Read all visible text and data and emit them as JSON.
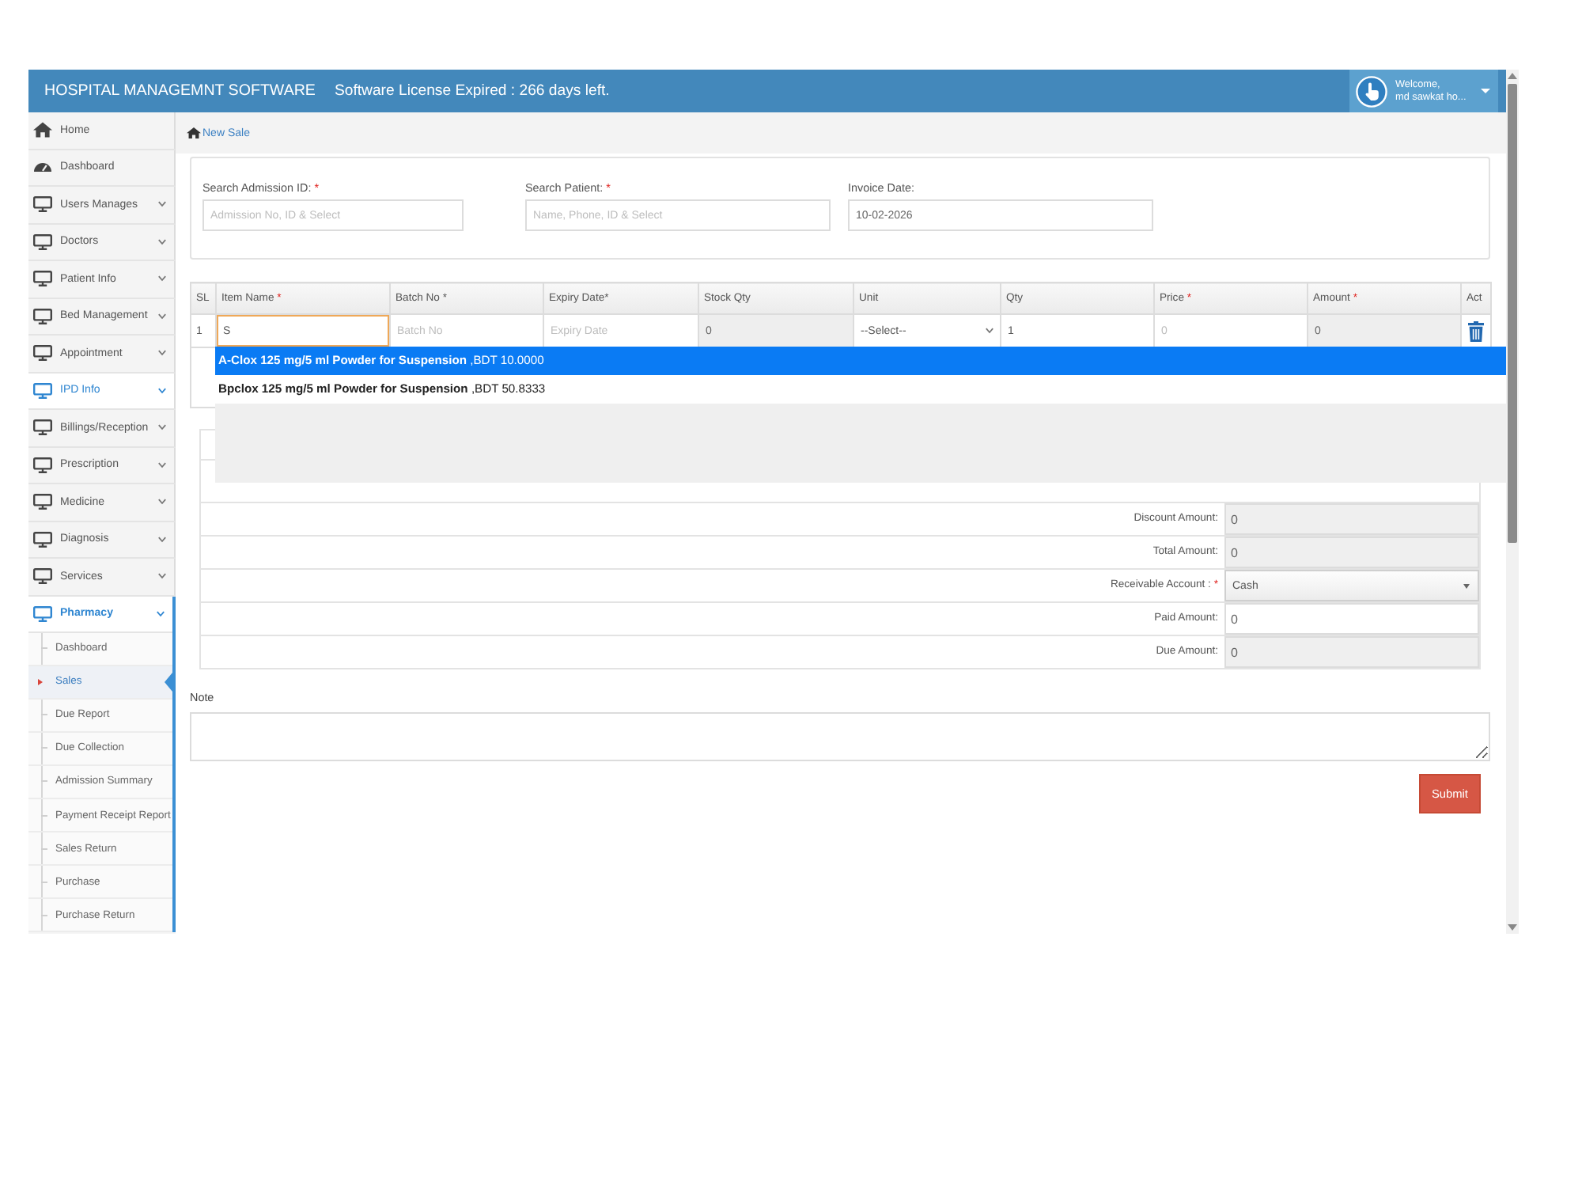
{
  "header": {
    "title": "HOSPITAL MANAGEMNT SOFTWARE",
    "notice": "Software License Expired : 266 days left.",
    "user": {
      "greeting": "Welcome,",
      "name": "md sawkat ho..."
    }
  },
  "sidebar": {
    "items": [
      {
        "label": "Home",
        "kind": "home",
        "active": false,
        "expanded": false
      },
      {
        "label": "Dashboard",
        "kind": "dashboard",
        "active": false,
        "expanded": false
      },
      {
        "label": "Users Manages",
        "kind": "menu",
        "active": false,
        "expanded": false
      },
      {
        "label": "Doctors",
        "kind": "menu",
        "active": false,
        "expanded": false
      },
      {
        "label": "Patient Info",
        "kind": "menu",
        "active": false,
        "expanded": false
      },
      {
        "label": "Bed Management",
        "kind": "menu",
        "active": false,
        "expanded": false
      },
      {
        "label": "Appointment",
        "kind": "menu",
        "active": false,
        "expanded": false
      },
      {
        "label": "IPD Info",
        "kind": "menu",
        "active": true,
        "expanded": false
      },
      {
        "label": "Billings/Reception",
        "kind": "menu",
        "active": false,
        "expanded": false
      },
      {
        "label": "Prescription",
        "kind": "menu",
        "active": false,
        "expanded": false
      },
      {
        "label": "Medicine",
        "kind": "menu",
        "active": false,
        "expanded": false
      },
      {
        "label": "Diagnosis",
        "kind": "menu",
        "active": false,
        "expanded": false
      },
      {
        "label": "Services",
        "kind": "menu",
        "active": false,
        "expanded": false
      },
      {
        "label": "Pharmacy",
        "kind": "menu",
        "active": true,
        "expanded": true,
        "children": [
          {
            "label": "Dashboard",
            "selected": false
          },
          {
            "label": "Sales",
            "selected": true
          },
          {
            "label": "Due Report",
            "selected": false
          },
          {
            "label": "Due Collection",
            "selected": false
          },
          {
            "label": "Admission Summary",
            "selected": false
          },
          {
            "label": "Payment Receipt Report",
            "selected": false
          },
          {
            "label": "Sales Return",
            "selected": false
          },
          {
            "label": "Purchase",
            "selected": false
          },
          {
            "label": "Purchase Return",
            "selected": false
          }
        ]
      }
    ]
  },
  "breadcrumb": {
    "label": "New Sale"
  },
  "search_form": {
    "fields": [
      {
        "label": "Search Admission ID:",
        "required_mark": "*",
        "placeholder": "Admission No, ID & Select"
      },
      {
        "label": "Search Patient:",
        "required_mark": "*",
        "placeholder": "Name, Phone, ID & Select"
      },
      {
        "label": "Invoice Date:",
        "value": "10-02-2026"
      }
    ]
  },
  "items_table": {
    "columns": [
      {
        "label": "SL"
      },
      {
        "label": "Item Name",
        "required_mark": "*"
      },
      {
        "label": "Batch No *"
      },
      {
        "label": "Expiry Date*"
      },
      {
        "label": "Stock Qty"
      },
      {
        "label": "Unit"
      },
      {
        "label": "Qty"
      },
      {
        "label": "Price",
        "required_mark": "*"
      },
      {
        "label": "Amount",
        "required_mark": "*"
      },
      {
        "label": "Act"
      }
    ],
    "rows": [
      {
        "cells": [
          {
            "kind": "number",
            "value": "1"
          },
          {
            "kind": "input",
            "value": "S",
            "focused": true
          },
          {
            "kind": "input",
            "placeholder": "Batch No",
            "focused": false
          },
          {
            "kind": "input",
            "placeholder": "Expiry Date",
            "focused": false
          },
          {
            "kind": "readonly",
            "value": "0"
          },
          {
            "kind": "select",
            "value": "--Select--"
          },
          {
            "kind": "input",
            "value": "1",
            "focused": false
          },
          {
            "kind": "input",
            "placeholder": "0",
            "focused": false
          },
          {
            "kind": "readonly",
            "value": "0"
          },
          {
            "kind": "action"
          }
        ]
      }
    ]
  },
  "suggestions": {
    "items": [
      {
        "text": "**A-Clox 125 mg/5 ml Powder for Suspension** ,BDT 10.0000",
        "selected": true
      },
      {
        "text": "**Bpclox 125 mg/5 ml Powder for Suspension** ,BDT 50.8333",
        "selected": false
      }
    ]
  },
  "summary": {
    "rows": [
      {
        "label": "Discount Amount:",
        "kind": "readonly",
        "value": "0"
      },
      {
        "label": "Total Amount:",
        "kind": "readonly",
        "value": "0"
      },
      {
        "label": "Receivable Account :",
        "required_mark": "*",
        "kind": "select",
        "value": "Cash"
      },
      {
        "label": "Paid Amount:",
        "kind": "input",
        "value": "0"
      },
      {
        "label": "Due Amount:",
        "kind": "readonly",
        "value": "0"
      }
    ]
  },
  "note": {
    "label": "Note"
  },
  "submit": {
    "label": "Submit"
  }
}
